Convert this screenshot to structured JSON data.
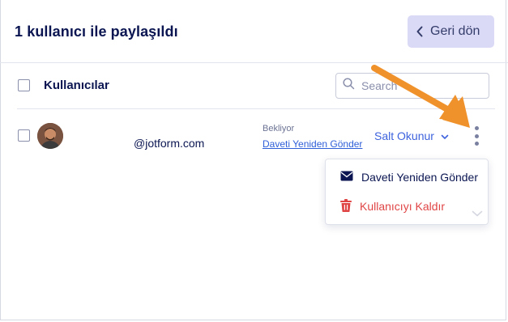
{
  "header": {
    "title": "1 kullanıcı ile paylaşıldı",
    "back_label": "Geri dön"
  },
  "list": {
    "column_label": "Kullanıcılar",
    "search_placeholder": "Search"
  },
  "user": {
    "email": "@jotform.com",
    "status": "Bekliyor",
    "resend_link": "Daveti Yeniden Gönder",
    "role": "Salt Okunur"
  },
  "menu": {
    "items": [
      {
        "label": "Daveti Yeniden Gönder",
        "icon": "envelope-icon",
        "color": "#0a1551"
      },
      {
        "label": "Kullanıcıyı Kaldır",
        "icon": "trash-icon",
        "color": "#e04545"
      }
    ]
  },
  "colors": {
    "accent": "#3e63dd",
    "back_button_bg": "#dadaf6",
    "danger": "#e04545",
    "annotation_arrow": "#f0922b"
  }
}
